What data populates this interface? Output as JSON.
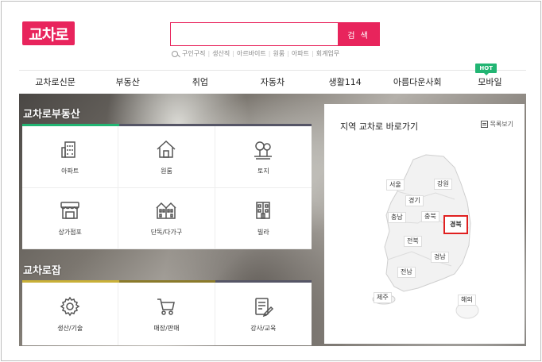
{
  "header": {
    "logo_text": "교차로",
    "search_placeholder": "",
    "search_button": "검 색",
    "keywords": [
      "구인구직",
      "생산직",
      "아르바이트",
      "원룸",
      "아파트",
      "회계업무"
    ]
  },
  "nav": {
    "items": [
      "교차로신문",
      "부동산",
      "취업",
      "자동차",
      "생활114",
      "아름다운사회",
      "모바일"
    ],
    "hot_badge": "HOT"
  },
  "real_estate": {
    "title": "교차로부동산",
    "items": [
      {
        "label": "아파트",
        "icon": "apartment-icon"
      },
      {
        "label": "원룸",
        "icon": "house-icon"
      },
      {
        "label": "토지",
        "icon": "land-icon"
      },
      {
        "label": "상가점포",
        "icon": "store-icon"
      },
      {
        "label": "단독/다가구",
        "icon": "townhouse-icon"
      },
      {
        "label": "빌라",
        "icon": "villa-icon"
      }
    ]
  },
  "jobs": {
    "title": "교차로잡",
    "items": [
      {
        "label": "생산/기술",
        "icon": "gear-icon"
      },
      {
        "label": "매장/판매",
        "icon": "cart-icon"
      },
      {
        "label": "강사/교육",
        "icon": "document-edit-icon"
      }
    ]
  },
  "region_map": {
    "title": "지역 교차로 바로가기",
    "list_link": "목록보기",
    "regions": [
      {
        "name": "서울",
        "active": false
      },
      {
        "name": "강원",
        "active": false
      },
      {
        "name": "경기",
        "active": false
      },
      {
        "name": "충북",
        "active": false
      },
      {
        "name": "충남",
        "active": false
      },
      {
        "name": "경북",
        "active": true
      },
      {
        "name": "전북",
        "active": false
      },
      {
        "name": "경남",
        "active": false
      },
      {
        "name": "전남",
        "active": false
      },
      {
        "name": "제주",
        "active": false
      },
      {
        "name": "해외",
        "active": false
      }
    ]
  },
  "colors": {
    "brand": "#e8245c",
    "real_estate_bar": "#22b573",
    "jobs_bar": "#c9b037",
    "dark_bar": "#555566",
    "hot": "#22b573",
    "active_region": "#e02020"
  }
}
